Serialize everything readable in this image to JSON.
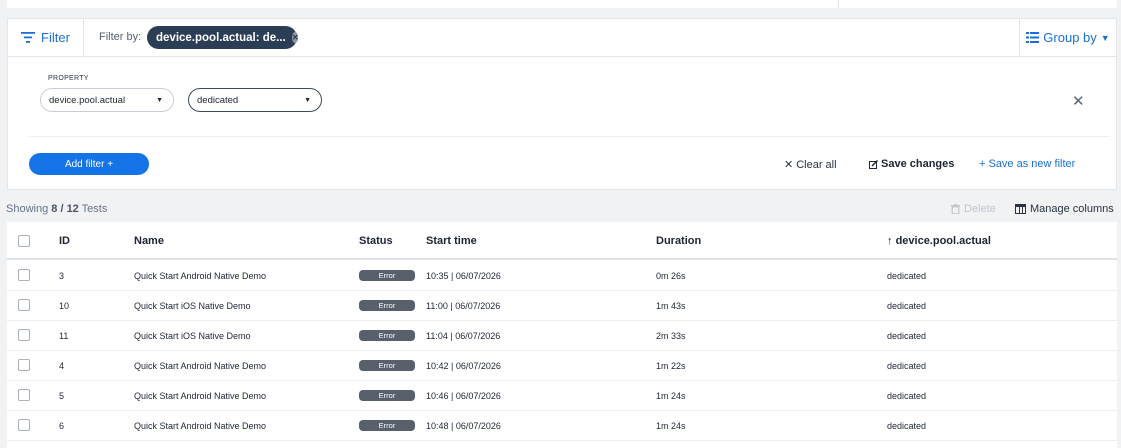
{
  "filter_bar": {
    "filter_label": "Filter",
    "filter_by_label": "Filter by:",
    "chip_label": "device.pool.actual: de...",
    "group_by_label": "Group by"
  },
  "filter_editor": {
    "property_label": "PROPERTY",
    "property_value": "device.pool.actual",
    "value_value": "dedicated",
    "add_filter_label": "Add filter +",
    "clear_all_label": "Clear all",
    "save_changes_label": "Save changes",
    "save_new_label": "+ Save as new filter"
  },
  "summary": {
    "showing_prefix": "Showing ",
    "shown_count": "8",
    "separator": " / ",
    "total_count": "12",
    "suffix": " Tests",
    "delete_label": "Delete",
    "manage_columns_label": "Manage columns"
  },
  "table": {
    "columns": [
      "ID",
      "Name",
      "Status",
      "Start time",
      "Duration",
      "device.pool.actual"
    ],
    "rows": [
      {
        "id": "3",
        "name": "Quick Start Android Native Demo",
        "status": "Error",
        "start": "10:35 | 06/07/2026",
        "duration": "0m 26s",
        "pool": "dedicated"
      },
      {
        "id": "10",
        "name": "Quick Start iOS Native Demo",
        "status": "Error",
        "start": "11:00 | 06/07/2026",
        "duration": "1m 43s",
        "pool": "dedicated"
      },
      {
        "id": "11",
        "name": "Quick Start iOS Native Demo",
        "status": "Error",
        "start": "11:04 | 06/07/2026",
        "duration": "2m 33s",
        "pool": "dedicated"
      },
      {
        "id": "4",
        "name": "Quick Start Android Native Demo",
        "status": "Error",
        "start": "10:42 | 06/07/2026",
        "duration": "1m 22s",
        "pool": "dedicated"
      },
      {
        "id": "5",
        "name": "Quick Start Android Native Demo",
        "status": "Error",
        "start": "10:46 | 06/07/2026",
        "duration": "1m 24s",
        "pool": "dedicated"
      },
      {
        "id": "6",
        "name": "Quick Start Android Native Demo",
        "status": "Error",
        "start": "10:48 | 06/07/2026",
        "duration": "1m 24s",
        "pool": "dedicated"
      }
    ]
  },
  "colors": {
    "accent": "#1a6fd6",
    "primary_button": "#1473e6",
    "chip": "#2c3e55",
    "error_badge": "#58606c"
  }
}
